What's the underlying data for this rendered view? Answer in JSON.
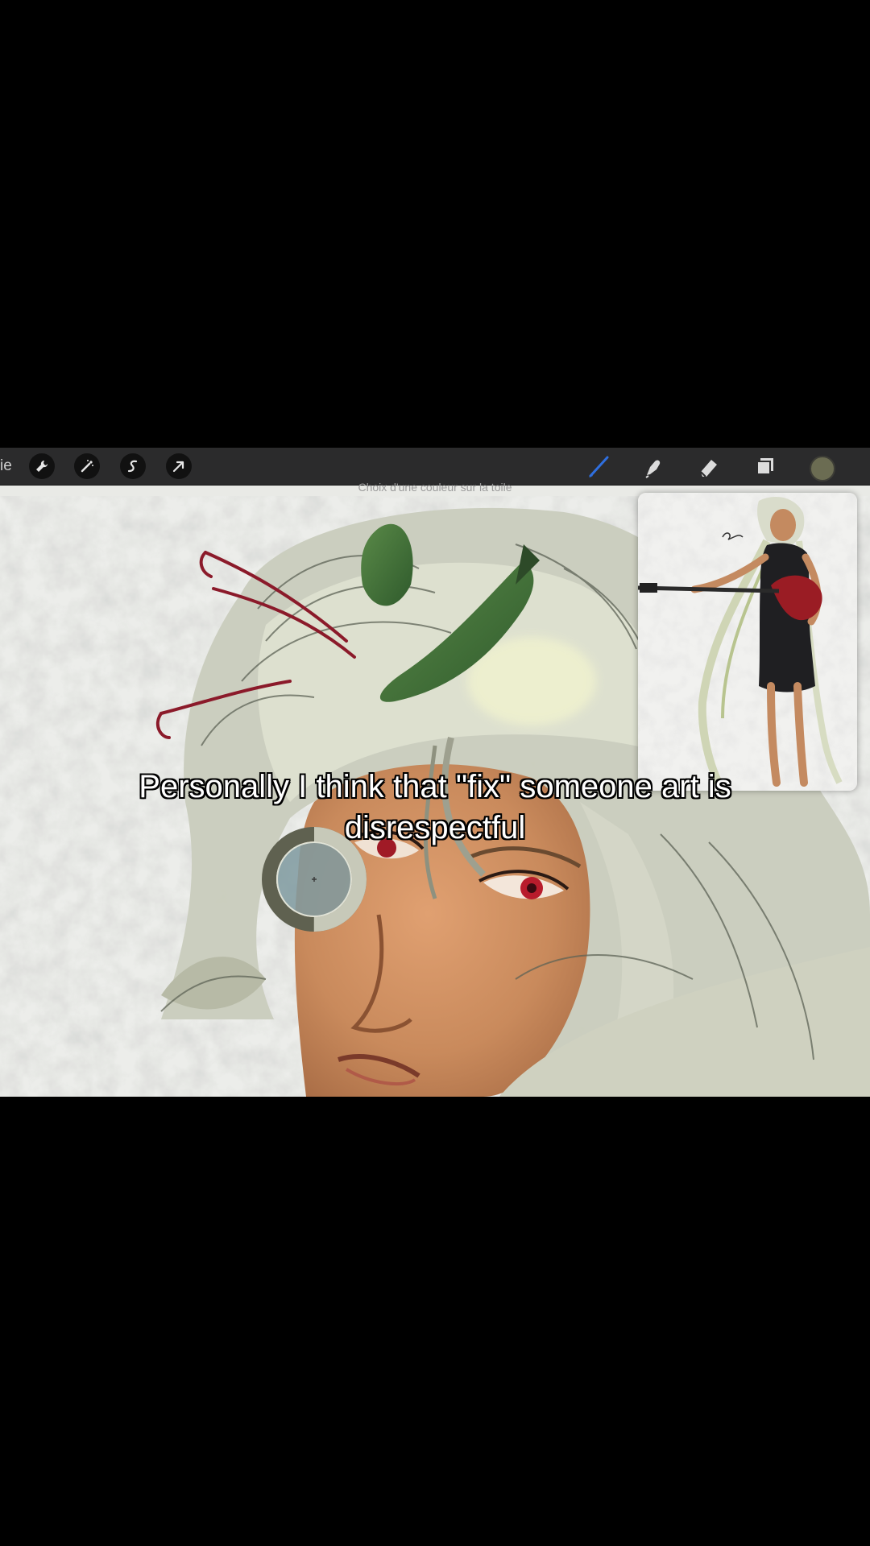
{
  "toolbar": {
    "gallery_label": "ie",
    "left_tools": [
      {
        "icon": "wrench-icon"
      },
      {
        "icon": "magic-wand-icon"
      },
      {
        "icon": "selection-icon"
      },
      {
        "icon": "transform-arrow-icon"
      }
    ],
    "right_tools": [
      {
        "icon": "brush-icon",
        "active": true
      },
      {
        "icon": "smudge-icon"
      },
      {
        "icon": "eraser-icon"
      },
      {
        "icon": "layers-icon"
      }
    ],
    "current_color": "#6b6c52",
    "accent_color": "#2f6fdf"
  },
  "toast": {
    "text": "Choix d'une couleur sur la toile"
  },
  "caption": {
    "line1": "Personally I think that \"fix\" someone art is",
    "line2": "disrespectful"
  },
  "eyedropper": {
    "sampled_color": "#7f9aa0"
  }
}
